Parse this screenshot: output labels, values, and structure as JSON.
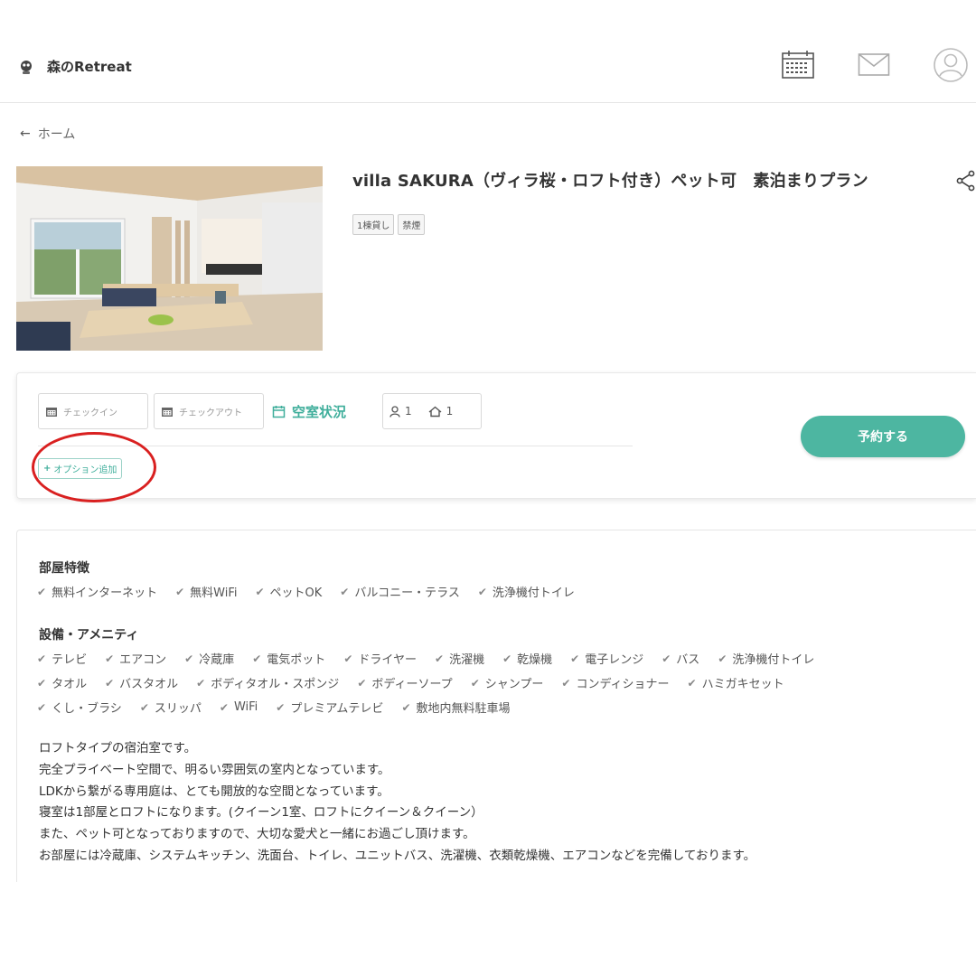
{
  "header": {
    "brand": "森のRetreat",
    "icons": [
      "calendar-icon",
      "mail-icon",
      "user-icon"
    ]
  },
  "breadcrumb": {
    "back_label": "ホーム"
  },
  "listing": {
    "title": "villa SAKURA（ヴィラ桜・ロフト付き）ペット可　素泊まりプラン",
    "tags": [
      "1棟貸し",
      "禁煙"
    ]
  },
  "booking": {
    "checkin_placeholder": "チェックイン",
    "checkout_placeholder": "チェックアウト",
    "availability_label": "空室状況",
    "adults": "1",
    "rooms": "1",
    "option_label": "オプション追加",
    "reserve_label": "予約する"
  },
  "room_features": {
    "title": "部屋特徴",
    "items": [
      "無料インターネット",
      "無料WiFi",
      "ペットOK",
      "バルコニー・テラス",
      "洗浄機付トイレ"
    ]
  },
  "amenities": {
    "title": "設備・アメニティ",
    "rows": [
      [
        "テレビ",
        "エアコン",
        "冷蔵庫",
        "電気ポット",
        "ドライヤー",
        "洗濯機",
        "乾燥機",
        "電子レンジ",
        "バス",
        "洗浄機付トイレ"
      ],
      [
        "タオル",
        "バスタオル",
        "ボディタオル・スポンジ",
        "ボディーソープ",
        "シャンプー",
        "コンディショナー",
        "ハミガキセット"
      ],
      [
        "くし・ブラシ",
        "スリッパ",
        "WiFi",
        "プレミアムテレビ",
        "敷地内無料駐車場"
      ]
    ]
  },
  "description": [
    "ロフトタイプの宿泊室です。",
    "完全プライベート空間で、明るい雰囲気の室内となっています。",
    "LDKから繋がる専用庭は、とても開放的な空間となっています。",
    "寝室は1部屋とロフトになります。(クイーン1室、ロフトにクイーン＆クイーン）",
    "また、ペット可となっておりますので、大切な愛犬と一緒にお過ごし頂けます。",
    "お部屋には冷蔵庫、システムキッチン、洗面台、トイレ、ユニットバス、洗濯機、衣類乾燥機、エアコンなどを完備しております。"
  ],
  "colors": {
    "accent": "#4db6a1",
    "annotation": "#d92020"
  }
}
